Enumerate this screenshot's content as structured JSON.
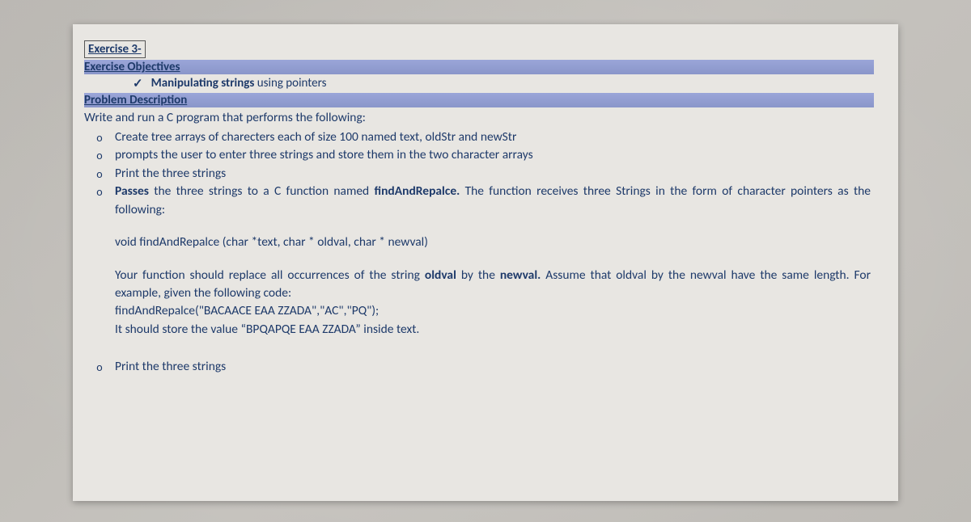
{
  "title": "Exercise 3-",
  "sections": {
    "objectives_header": "Exercise Objectives",
    "objective_checkmark": "✓",
    "objective_bold": "Manipulating strings ",
    "objective_rest": "using pointers",
    "problem_header": "Problem Description",
    "intro": "Write and run a C program that performs the following:"
  },
  "bullets": {
    "b1": "Create tree arrays of charecters each of size 100 named text, oldStr and newStr",
    "b2": "prompts the user to enter three strings and store them in the two character arrays",
    "b3": "Print the three strings",
    "b4_pre": "Passes",
    "b4_mid": " the three strings to a C function named ",
    "b4_func": "findAndRepalce.",
    "b4_post": " The function receives three Strings in the form of character pointers as the following:",
    "b5": "Print the three strings"
  },
  "signature": "void findAndRepalce (char *text, char * oldval, char * newval)",
  "description": {
    "d1_pre": "Your function should replace all occurrences of the string ",
    "d1_old": "oldval",
    "d1_mid": " by the ",
    "d1_new": "newval.",
    "d1_post": " Assume that oldval by the newval have  the same length. For example, given the following code:",
    "d2": "findAndRepalce(\"BACAACE EAA ZZADA\",\"AC\",\"PQ\");",
    "d3": "It should store the value “BPQAPQE EAA ZZADA” inside text."
  }
}
